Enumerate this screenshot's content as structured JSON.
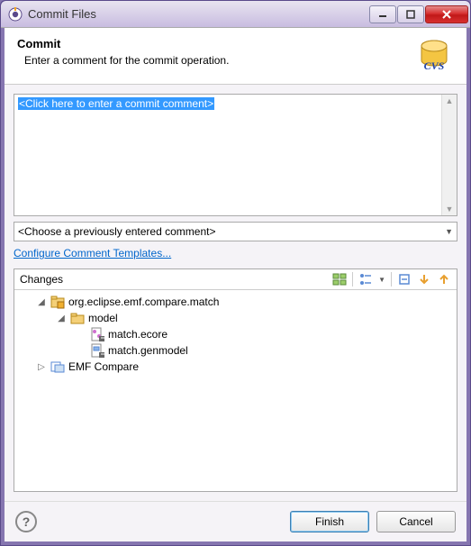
{
  "window": {
    "title": "Commit Files"
  },
  "header": {
    "title": "Commit",
    "subtitle": "Enter a comment for the commit operation.",
    "badge": "CVS"
  },
  "comment": {
    "placeholder": "<Click here to enter a commit comment>"
  },
  "history": {
    "selected": "<Choose a previously entered comment>"
  },
  "links": {
    "templates": "Configure Comment Templates..."
  },
  "changes": {
    "title": "Changes",
    "tree": {
      "proj": "org.eclipse.emf.compare.match",
      "folder": "model",
      "file1": "match.ecore",
      "file2": "match.genmodel",
      "wset": "EMF Compare"
    }
  },
  "buttons": {
    "finish": "Finish",
    "cancel": "Cancel"
  }
}
